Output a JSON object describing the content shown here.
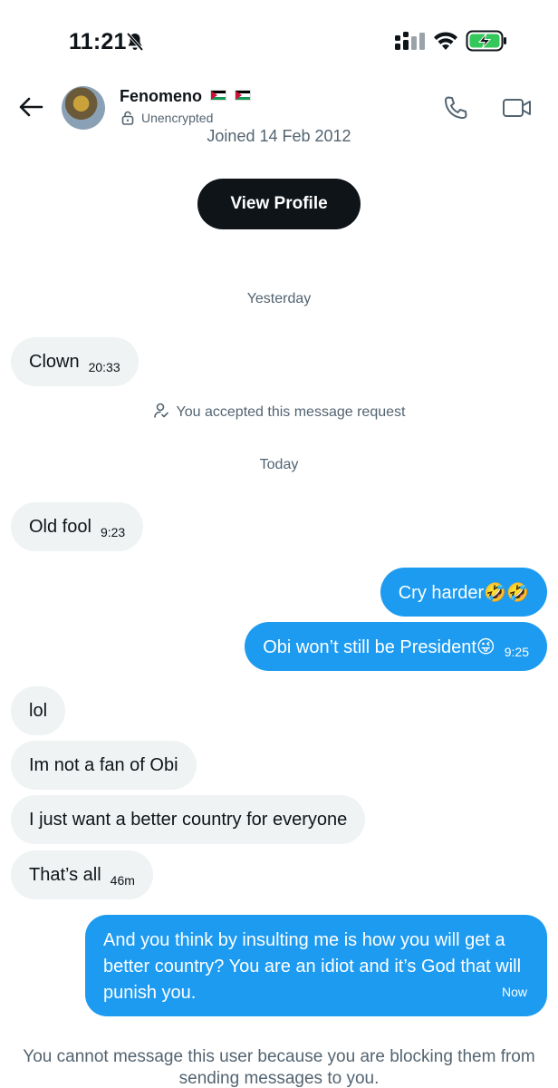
{
  "status_bar": {
    "time": "11:21"
  },
  "header": {
    "name": "Fenomeno",
    "encryption": "Unencrypted"
  },
  "profile": {
    "joined": "Joined 14 Feb 2012",
    "view_profile_label": "View Profile"
  },
  "days": {
    "yesterday": "Yesterday",
    "today": "Today"
  },
  "notice": "You accepted this message request",
  "messages": [
    {
      "text": "Clown",
      "time": "20:33",
      "direction": "incoming"
    },
    {
      "text": "Old fool",
      "time": "9:23",
      "direction": "incoming"
    },
    {
      "text": "Cry harder🤣🤣",
      "time": "",
      "direction": "outgoing"
    },
    {
      "text": "Obi won’t still be President😜",
      "time": "9:25",
      "direction": "outgoing"
    },
    {
      "text": "lol",
      "time": "",
      "direction": "incoming"
    },
    {
      "text": "Im not a fan of Obi",
      "time": "",
      "direction": "incoming"
    },
    {
      "text": "I just want a better country for everyone",
      "time": "",
      "direction": "incoming"
    },
    {
      "text": "That’s all",
      "time": "46m",
      "direction": "incoming"
    },
    {
      "text": "And you think by insulting me is how you will get a better country? You are an idiot and it’s God that will punish you.",
      "time": "Now",
      "direction": "outgoing"
    }
  ],
  "blocked_notice": "You cannot message this user because you are blocking them from sending messages to you.",
  "colors": {
    "outgoing_bubble": "#1d9bf0",
    "incoming_bubble": "#eff3f4",
    "muted_text": "#536471",
    "button_dark": "#0f1419"
  },
  "icons": [
    "bell-off-icon",
    "signal-icon",
    "wifi-icon",
    "battery-charging-icon",
    "back-arrow-icon",
    "lock-icon",
    "phone-icon",
    "video-icon",
    "person-check-icon"
  ]
}
